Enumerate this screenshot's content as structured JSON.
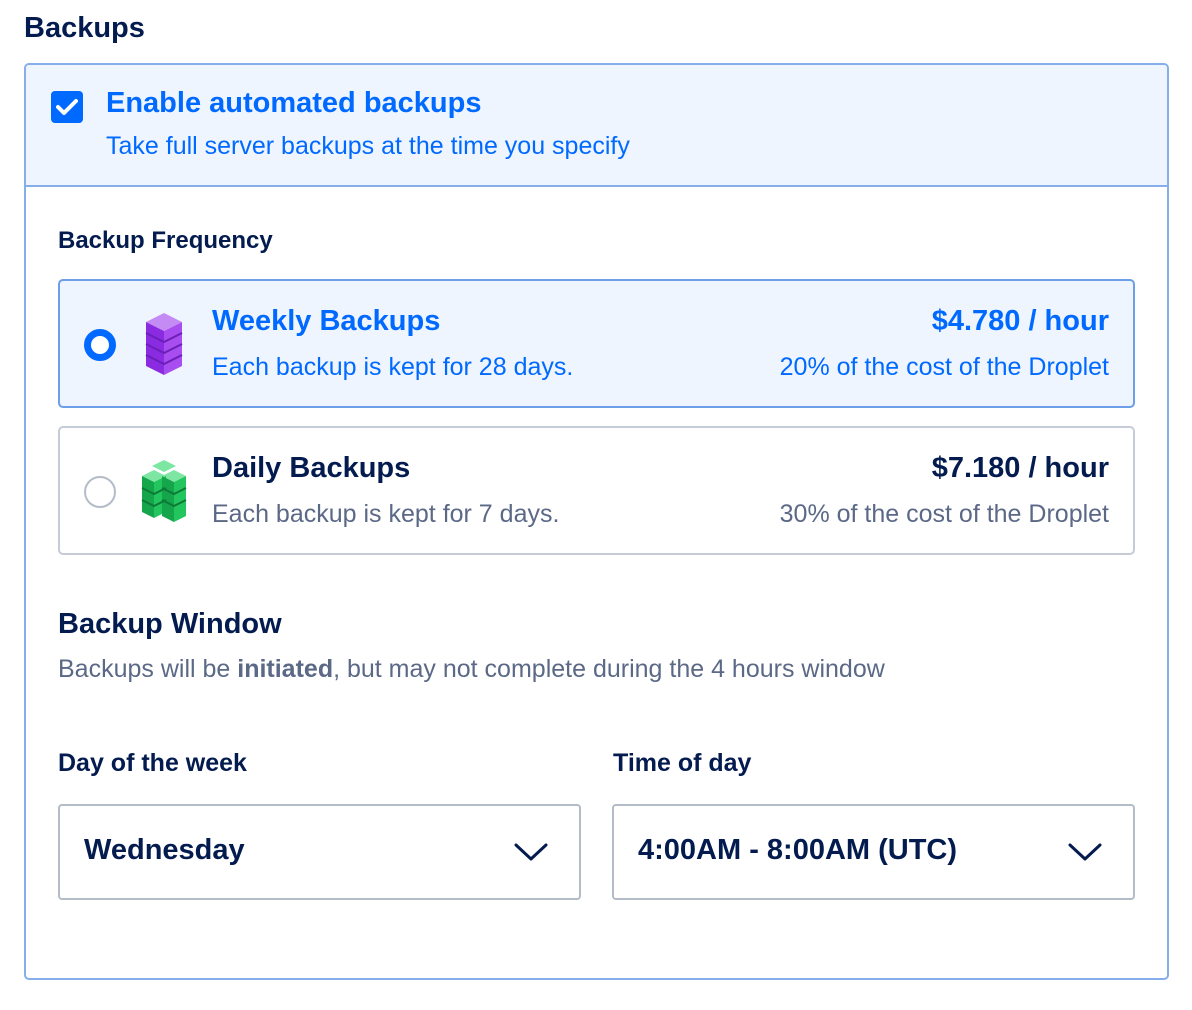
{
  "section": {
    "title": "Backups"
  },
  "enable": {
    "checked": true,
    "title": "Enable automated backups",
    "subtitle": "Take full server backups at the time you specify"
  },
  "frequency": {
    "label": "Backup Frequency",
    "options": [
      {
        "title": "Weekly Backups",
        "subtitle": "Each backup is kept for 28 days.",
        "price": "$4.780 / hour",
        "cost_note": "20% of the cost of the Droplet",
        "selected": true,
        "icon": "purple-stack-icon"
      },
      {
        "title": "Daily Backups",
        "subtitle": "Each backup is kept for 7 days.",
        "price": "$7.180 / hour",
        "cost_note": "30% of the cost of the Droplet",
        "selected": false,
        "icon": "green-stack-icon"
      }
    ]
  },
  "window": {
    "title": "Backup Window",
    "subtitle_pre": "Backups will be ",
    "subtitle_bold": "initiated",
    "subtitle_post": ", but may not complete during the 4 hours window"
  },
  "day": {
    "label": "Day of the week",
    "value": "Wednesday"
  },
  "time": {
    "label": "Time of day",
    "value": "4:00AM - 8:00AM (UTC)"
  },
  "colors": {
    "accent": "#0069ff",
    "selected_bg": "#eef5fe",
    "text_dark": "#031b4e",
    "text_muted": "#5b6987",
    "purple": "#9b3dea",
    "green": "#1fc15b"
  }
}
